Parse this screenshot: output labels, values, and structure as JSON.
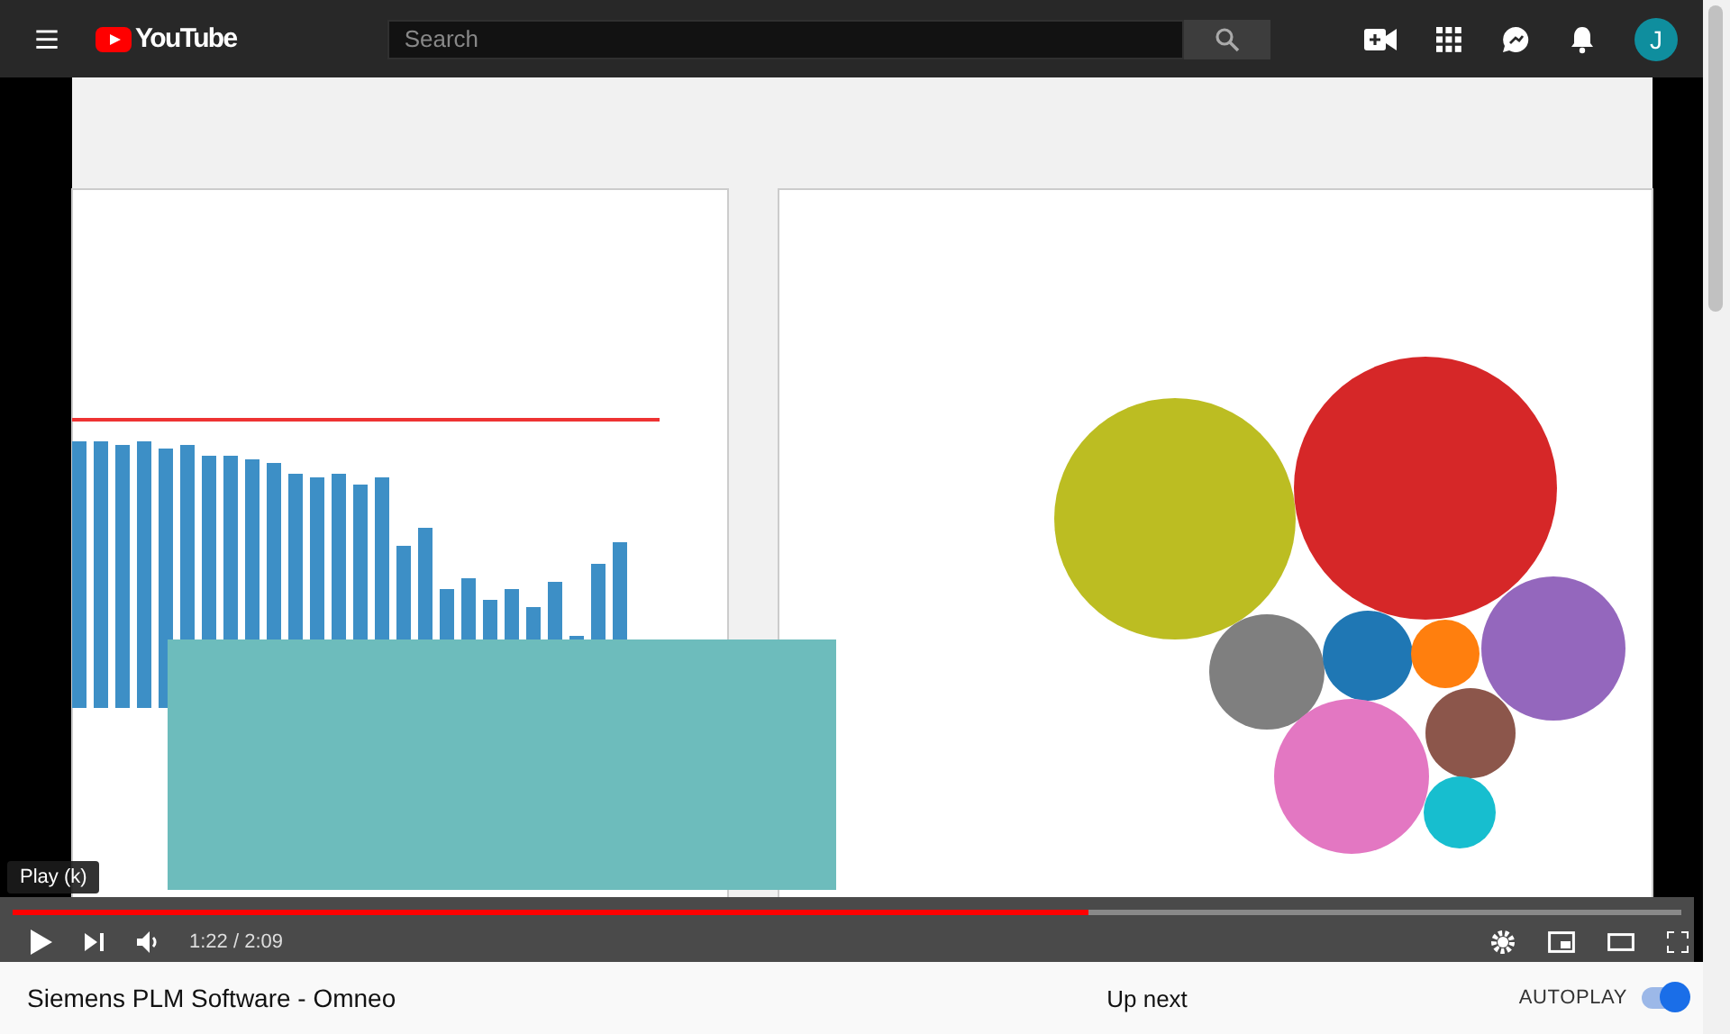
{
  "header": {
    "logo": "YouTube",
    "search": {
      "placeholder": "Search"
    },
    "avatar": "J"
  },
  "player": {
    "tooltip": "Play (k)",
    "progress": {
      "level": 0.645
    },
    "time": "1:22 / 2:09"
  },
  "below": {
    "title": "Siemens PLM Software - Omneo",
    "up_next": "Up next",
    "autoplay": {
      "label": "AUTOPLAY",
      "on": true
    }
  }
}
